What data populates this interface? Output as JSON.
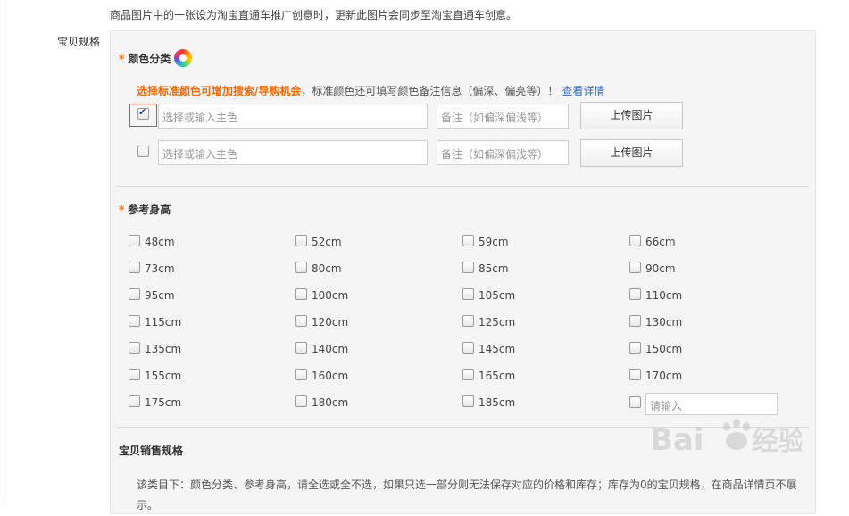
{
  "notice": "商品图片中的一张设为淘宝直通车推广创意时，更新此图片会同步至淘宝直通车创意。",
  "spec_label": "宝贝规格",
  "color": {
    "required_mark": "*",
    "title": "颜色分类",
    "tip_highlight": "选择标准颜色可增加搜索/导购机会",
    "tip_rest": "，标准颜色还可填写颜色备注信息（偏深、偏亮等）！",
    "tip_link": "查看详情",
    "rows": [
      {
        "checked": true,
        "main_placeholder": "选择或输入主色",
        "note_placeholder": "备注（如偏深偏浅等）",
        "upload_label": "上传图片"
      },
      {
        "checked": false,
        "main_placeholder": "选择或输入主色",
        "note_placeholder": "备注（如偏深偏浅等）",
        "upload_label": "上传图片"
      }
    ]
  },
  "height": {
    "required_mark": "*",
    "title": "参考身高",
    "options": [
      "48cm",
      "52cm",
      "59cm",
      "66cm",
      "73cm",
      "80cm",
      "85cm",
      "90cm",
      "95cm",
      "100cm",
      "105cm",
      "110cm",
      "115cm",
      "120cm",
      "125cm",
      "130cm",
      "135cm",
      "140cm",
      "145cm",
      "150cm",
      "155cm",
      "160cm",
      "165cm",
      "170cm",
      "175cm",
      "180cm",
      "185cm"
    ],
    "custom_placeholder": "请输入"
  },
  "sales": {
    "title": "宝贝销售规格",
    "note": "该类目下：颜色分类、参考身高，请全选或全不选，如果只选一部分则无法保存对应的价格和库存；库存为0的宝贝规格，在商品详情页不展示。"
  },
  "watermark": {
    "brand": "Baidu",
    "product": "经验"
  }
}
